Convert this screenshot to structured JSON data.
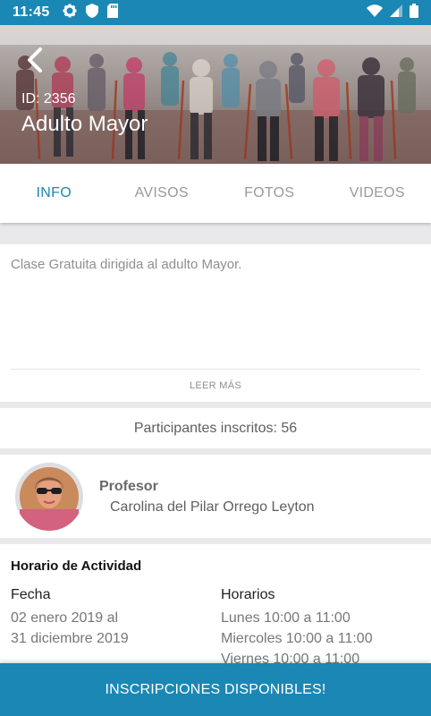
{
  "status_bar": {
    "time": "11:45",
    "left_icons": [
      "gear-icon",
      "shield-icon",
      "sd-card-icon"
    ],
    "right_icons": [
      "wifi-icon",
      "signal-icon",
      "battery-icon"
    ]
  },
  "header": {
    "id_text": "ID: 2356",
    "title": "Adulto Mayor"
  },
  "tabs": [
    {
      "label": "INFO",
      "active": true
    },
    {
      "label": "AVISOS",
      "active": false
    },
    {
      "label": "FOTOS",
      "active": false
    },
    {
      "label": "VIDEOS",
      "active": false
    }
  ],
  "description": {
    "text": "Clase Gratuita dirigida al adulto Mayor.",
    "read_more": "LEER MÁS"
  },
  "participants": {
    "text": "Participantes inscritos: 56"
  },
  "professor": {
    "label": "Profesor",
    "name": "Carolina del Pilar Orrego Leyton"
  },
  "schedule": {
    "title": "Horario de Actividad",
    "date_header": "Fecha",
    "dates": [
      "02 enero 2019 al",
      "31 diciembre 2019"
    ],
    "hours_header": "Horarios",
    "hours": [
      "Lunes 10:00 a 11:00",
      "Miercoles 10:00 a 11:00",
      "Viernes 10:00 a 11:00"
    ]
  },
  "cta": {
    "label": "INSCRIPCIONES DISPONIBLES!"
  },
  "colors": {
    "primary": "#1b87b5",
    "background": "#e9e9ec"
  }
}
